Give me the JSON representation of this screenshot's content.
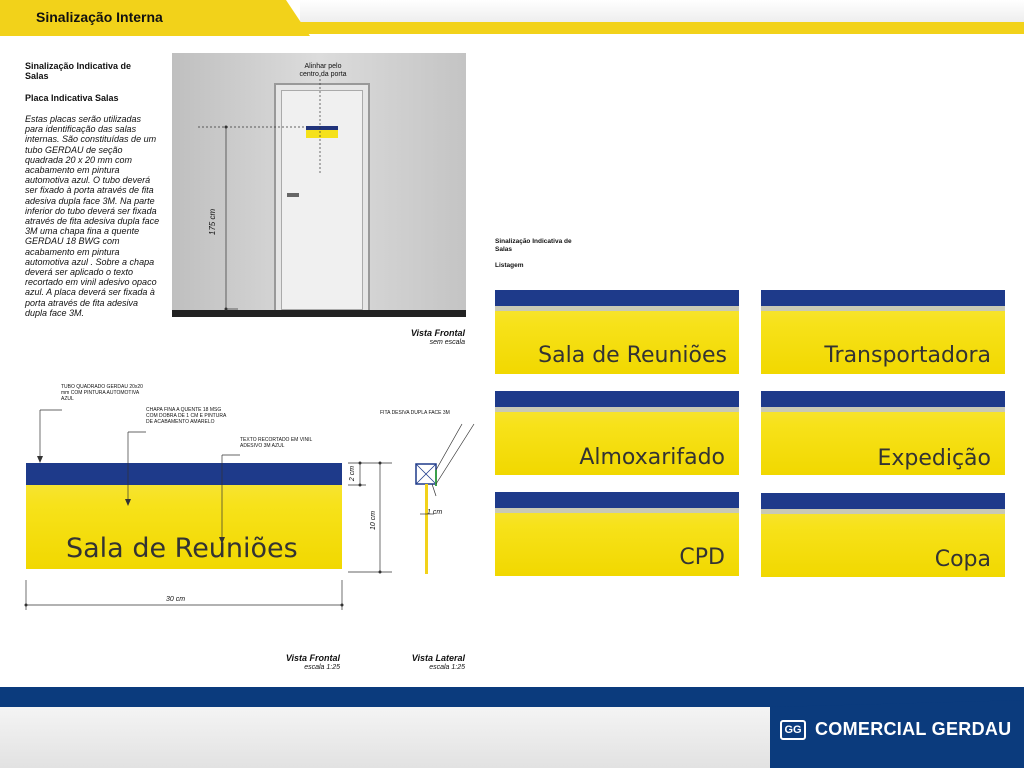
{
  "header": {
    "title": "Sinalização Interna"
  },
  "left": {
    "heading": "Sinalização Indicativa de Salas",
    "subheading": "Placa Indicativa Salas",
    "description": "Estas placas serão utilizadas para identificação das salas internas. São constituídas de um tubo GERDAU de seção quadrada 20 x 20 mm com acabamento em pintura automotiva azul. O tubo deverá ser fixado à porta através de fita adesiva dupla face 3M. Na parte inferior do tubo deverá ser fixada através de fita adesiva dupla face 3M uma chapa fina a quente GERDAU 18 BWG com acabamento em pintura automotiva azul . Sobre a chapa deverá ser aplicado o texto recortado em vinil adesivo opaco azul. A placa deverá ser fixada à porta através de fita adesiva dupla face 3M."
  },
  "photo": {
    "align_label": "Alinhar pelo centro da porta",
    "height_label": "175 cm",
    "view_title": "Vista Frontal",
    "view_scale": "sem escala"
  },
  "drawing": {
    "note_tube": "TUBO QUADRADO GERDAU 20x20 mm COM PINTURA AUTOMOTIVA AZUL",
    "note_plate": "CHAPA FINA A QUENTE 18 MSG COM DOBRA DE 1 CM E PINTURA DE ACABAMENTO AMARELO",
    "note_text": "TEXTO RECORTADO EM VINIL ADESIVO 3M AZUL",
    "note_tape": "FITA DESIVA DUPLA FACE 3M",
    "sign_text": "Sala de Reuniões",
    "dim_2": "2 cm",
    "dim_10": "10 cm",
    "dim_1": "1 cm",
    "dim_30": "30 cm",
    "front_title": "Vista Frontal",
    "front_scale": "escala 1:25",
    "side_title": "Vista Lateral",
    "side_scale": "escala 1:25"
  },
  "listing": {
    "heading": "Sinalização Indicativa de Salas",
    "subheading": "Listagem",
    "signs": [
      "Sala de Reuniões",
      "Transportadora",
      "Almoxarifado",
      "Expedição",
      "CPD",
      "Copa"
    ]
  },
  "footer": {
    "logo_mark": "GG",
    "logo_text": "COMERCIAL GERDAU"
  },
  "colors": {
    "brand_blue": "#1e3a8a",
    "brand_yellow": "#f2d21a",
    "footer_blue": "#0b3b7d"
  }
}
